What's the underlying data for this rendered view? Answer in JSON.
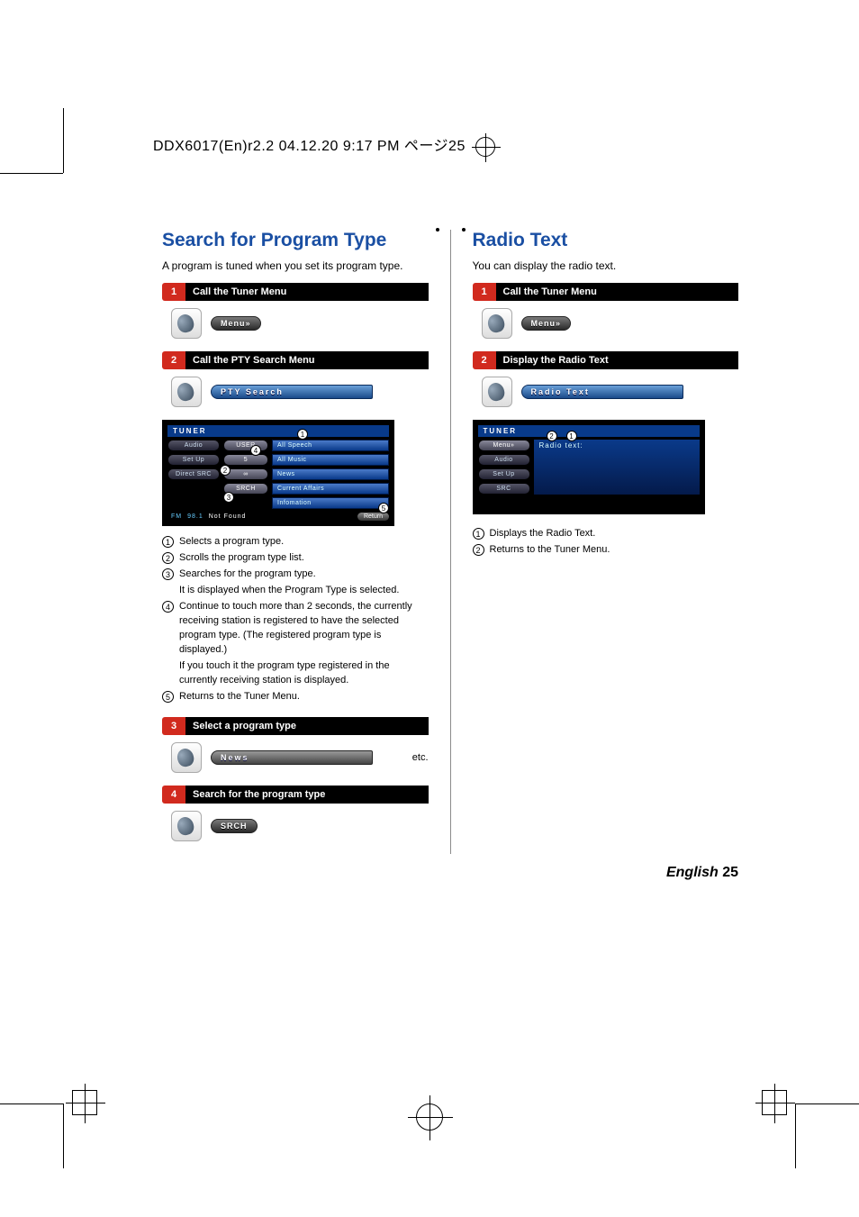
{
  "slug": "DDX6017(En)r2.2  04.12.20  9:17 PM  ページ25",
  "page_label": "English",
  "page_number": "25",
  "left": {
    "title": "Search for Program Type",
    "lead": "A program is tuned when you set its program type.",
    "steps": {
      "s1_num": "1",
      "s1_label": "Call the Tuner Menu",
      "s1_btn": "Menu»",
      "s2_num": "2",
      "s2_label": "Call the PTY Search Menu",
      "s2_btn": "PTY Search",
      "s3_num": "3",
      "s3_label": "Select a program type",
      "s3_btn": "News",
      "s3_etc": "etc.",
      "s4_num": "4",
      "s4_label": "Search for the program type",
      "s4_btn": "SRCH"
    },
    "tuner": {
      "header": "TUNER",
      "left_buttons": [
        "Audio",
        "Set Up",
        "Direct SRC"
      ],
      "mid_buttons": [
        "USER",
        "5",
        "∞",
        "SRCH"
      ],
      "list": [
        "All Speech",
        "All Music",
        "News",
        "Current Affairs",
        "Infomation"
      ],
      "band": "FM",
      "freq": "98.1",
      "not_found": "Not Found",
      "return": "Return",
      "callouts": {
        "c1": "1",
        "c2": "2",
        "c3": "3",
        "c4": "4",
        "c5": "5"
      }
    },
    "notes": {
      "n1": "Selects a program type.",
      "n2": "Scrolls the program type list.",
      "n3a": "Searches for the program type.",
      "n3b": "It is displayed when the Program Type is selected.",
      "n4a": "Continue to touch more than 2 seconds, the currently receiving station is registered to have the selected program type. (The registered program type is displayed.)",
      "n4b": "If you touch it the program type registered in the currently receiving station is displayed.",
      "n5": "Returns to the Tuner Menu."
    }
  },
  "right": {
    "title": "Radio Text",
    "lead": "You can display the radio text.",
    "steps": {
      "s1_num": "1",
      "s1_label": "Call the Tuner Menu",
      "s1_btn": "Menu»",
      "s2_num": "2",
      "s2_label": "Display the Radio Text",
      "s2_btn": "Radio Text"
    },
    "radio": {
      "header": "TUNER",
      "left_buttons": [
        "Audio",
        "Set Up",
        "SRC"
      ],
      "menu_btn": "Menu»",
      "text_label": "Radio text:",
      "callouts": {
        "c1": "1",
        "c2": "2"
      }
    },
    "notes": {
      "n1": "Displays the Radio Text.",
      "n2": "Returns to the Tuner Menu."
    }
  }
}
